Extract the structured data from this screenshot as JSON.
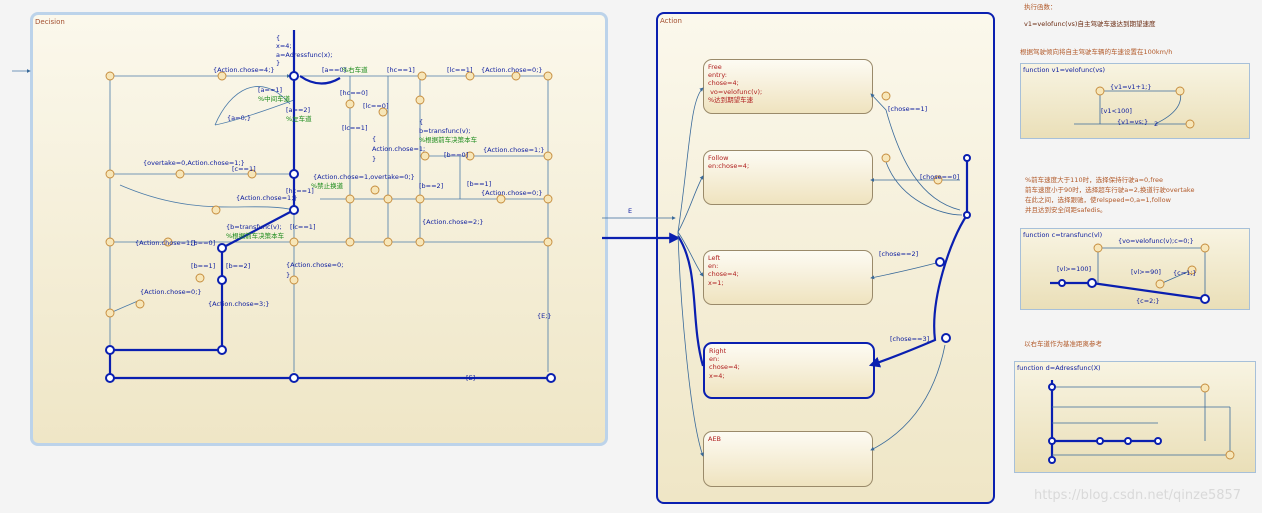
{
  "decision": {
    "title": "Decision",
    "entry": [
      "{",
      "x=4;",
      "a=Adressfunc(x);",
      "}"
    ],
    "labels": [
      "{Action.chose=4;}",
      "[a==0]",
      "%右车道",
      "[a==1]",
      "%中间车道",
      "[a==2]",
      "%左车道",
      "{a=0;}",
      "{overtake=0,Action.chose=1;}",
      "[c==1]",
      "{Action.chose=1;}",
      "[hc==1]",
      "%禁止换道",
      "[hc==1]",
      "[lc==1]",
      "{Action.chose=0;}",
      "[hc==0]",
      "[lc==0]",
      "[lc==1]",
      "{",
      "Action.chose=1;",
      "}",
      "{Action.chose=1,overtake=0;}",
      "{",
      "b=transfunc(v);",
      "%根据前车决策本车",
      "[b==0]",
      "{Action.chose=1;}",
      "[b==2]",
      "[b==1]",
      "{Action.chose=0;}",
      "{Action.chose=2;}",
      "{b=transfunc(v);",
      "%根据前车决策本车",
      "[lc==1]",
      "{Action.chose=1;}",
      "[b==0]",
      "[b==1]",
      "[b==2]",
      "{Action.chose=0;}",
      "{Action.chose=0;",
      "}",
      "{Action.chose=3;}",
      "{E;}",
      "[E]"
    ]
  },
  "action": {
    "title": "Action",
    "transition_E": "E",
    "states": [
      {
        "lines": "Free\nentry:\nchose=4;\n vo=velofunc(v);\n%达到期望车速"
      },
      {
        "lines": "Follow\nen:chose=4;"
      },
      {
        "lines": "Left\nen:\nchose=4;\nx=1;"
      },
      {
        "lines": "Right\nen:\nchose=4;\nx=4;"
      },
      {
        "lines": "AEB"
      }
    ],
    "conditions": [
      "[chose==1]",
      "[chose==0]",
      "[chose==2]",
      "[chose==3]"
    ]
  },
  "notes": {
    "exec_title": "执行函数：",
    "exec_line": "v1=velofunc(vs)自主驾驶车速达到期望速度",
    "exec_desc": "根据驾驶倾向将自主驾驶车辆的车速设置在100km/h",
    "mid_note": [
      "%前车速度大于110时，选择保持行驶a=0,free",
      "前车速度小于90时，选择超车行驶a=2,换道行驶overtake",
      "在此之间，选择跟驰，使relspeed=0,a=1,follow",
      "并且达到安全间距safedis。"
    ],
    "ref_note": "以右车道作为基准距离参考"
  },
  "functions": [
    {
      "title": "function  v1=velofunc(vs)",
      "labels": [
        "{v1=v1+1;}",
        "[v1<100]",
        "{v1=vs;}",
        "2"
      ]
    },
    {
      "title": "function  c=transfunc(vl)",
      "labels": [
        "{vo=velofunc(v);c=0;}",
        "[vl>=100]",
        "[vl>=90]",
        "{c=1;}",
        "{c=2;}"
      ]
    },
    {
      "title": "function  d=Adressfunc(X)",
      "labels": []
    }
  ],
  "watermark": "https://blog.csdn.net/qinze5857"
}
